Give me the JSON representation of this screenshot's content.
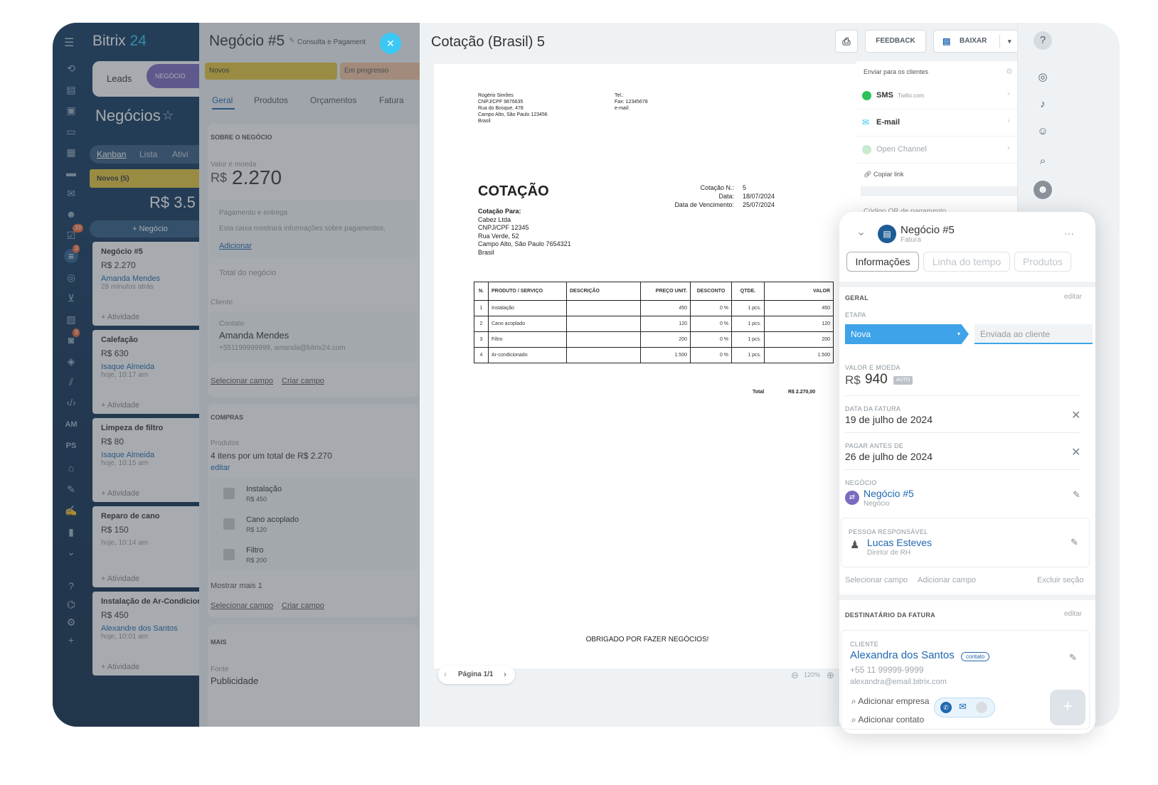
{
  "rail": {
    "brand_name": "Bitrix",
    "brand_num": "24",
    "badge_tasks": "33",
    "badge_crm": "3",
    "badge_mail": "3",
    "label_am": "AM",
    "label_ps": "PS"
  },
  "kanban": {
    "tab_leads": "Leads",
    "tab_deal": "NEGÓCIO",
    "title": "Negócios",
    "views": [
      "Kanban",
      "Lista",
      "Ativi"
    ],
    "column_name": "Novos (5)",
    "column_total": "R$ 3.5",
    "add_deal": "+ Negócio",
    "cards": [
      {
        "title": "Negócio #5",
        "price": "R$ 2.270",
        "person": "Amanda Mendes",
        "date": "28 minutos atrás",
        "activity": "+ Atividade"
      },
      {
        "title": "Calefação",
        "price": "R$ 630",
        "person": "Isaque Almeida",
        "date": "hoje, 10:17 am",
        "activity": "+ Atividade"
      },
      {
        "title": "Limpeza de filtro",
        "price": "R$ 80",
        "person": "Isaque Almeida",
        "date": "hoje, 10:15 am",
        "activity": "+ Atividade"
      },
      {
        "title": "Reparo de cano",
        "price": "R$ 150",
        "person": "",
        "date": "hoje, 10:14 am",
        "activity": "+ Atividade"
      },
      {
        "title": "Instalação de Ar-Condicion",
        "price": "R$ 450",
        "person": "Alexandre dos Santos",
        "date": "hoje, 10:01 am",
        "activity": "+ Atividade"
      }
    ]
  },
  "deal": {
    "title": "Negócio #5",
    "subtitle": "Consulta e Pagament",
    "stage_current": "Novos",
    "stage_next": "Em progresso",
    "tabs": [
      "Geral",
      "Produtos",
      "Orçamentos",
      "Fatura"
    ],
    "about_header": "SOBRE O NEGÓCIO",
    "value_label": "Valor e moeda",
    "currency": "R$",
    "amount": "2.270",
    "payment_label": "Pagamento e entrega",
    "payment_text": "Esta caixa mostrará informações sobre pagamentos,",
    "payment_add": "Adicionar",
    "total_label": "Total do negócio",
    "client_label": "Cliente",
    "contact_label": "Contato",
    "contact_name": "Amanda Mendes",
    "contact_info": "+551199999999, amanda@bitrix24.com",
    "select_field": "Selecionar campo",
    "create_field": "Criar campo",
    "purchases_header": "COMPRAS",
    "products_label": "Produtos",
    "products_summary": "4 itens por um total de R$ 2.270",
    "products_edit": "editar",
    "products": [
      {
        "name": "Instalação",
        "price": "R$ 450"
      },
      {
        "name": "Cano acoplado",
        "price": "R$ 120"
      },
      {
        "name": "Filtro",
        "price": "R$ 200"
      }
    ],
    "show_more": "Mostrar mais 1",
    "more_header": "MAIS",
    "source_label": "Fonte",
    "source_value": "Publicidade"
  },
  "viewer": {
    "title": "Cotação (Brasil) 5",
    "feedback": "FEEDBACK",
    "download": "BAIXAR",
    "page_label": "Página 1/1",
    "zoom": "120%"
  },
  "document": {
    "seller_lines": [
      "Rogério Simões",
      "CNPJ/CPF 9876635",
      "Rua do Bosque, 478",
      "Campo Alto, São Paulo 123456",
      "Brasil"
    ],
    "seller_contact": [
      "Tel.:",
      "Fax: 12345678",
      "e-mail:"
    ],
    "heading": "COTAÇÃO",
    "meta_labels": [
      "Cotação N.:",
      "Data:",
      "Data de Vencimento:"
    ],
    "meta_values": [
      "5",
      "18/07/2024",
      "25/07/2024"
    ],
    "to_label": "Cotação Para:",
    "to_lines": [
      "Cabez Ltda",
      "CNPJ/CPF 12345",
      "Rua Verde, 52",
      "Campo Alto, São Paulo 7654321",
      "Brasil"
    ],
    "columns": [
      "N.",
      "PRODUTO / SERVIÇO",
      "DESCRIÇÃO",
      "PREÇO UNIT.",
      "DESCONTO",
      "QTDE.",
      "VALOR"
    ],
    "rows": [
      [
        "1",
        "Instalação",
        "",
        "450",
        "0 %",
        "1 pcs.",
        "450"
      ],
      [
        "2",
        "Cano acoplado",
        "",
        "120",
        "0 %",
        "1 pcs.",
        "120"
      ],
      [
        "3",
        "Filtro",
        "",
        "200",
        "0 %",
        "1 pcs.",
        "200"
      ],
      [
        "4",
        "Ar-condicionado",
        "",
        "1.500",
        "0 %",
        "1 pcs.",
        "1.500"
      ]
    ],
    "total_label": "Total",
    "total_value": "R$ 2.270,00",
    "thanks": "OBRIGADO POR FAZER NEGÓCIOS!"
  },
  "send": {
    "header": "Enviar para os clientes",
    "sms": "SMS",
    "sms_provider": "Twilio.com",
    "email": "E-mail",
    "open_channel": "Open Channel",
    "copy_link": "Copiar link",
    "qr_label": "Código QR de pagamento"
  },
  "invoice": {
    "title": "Negócio #5",
    "subtitle": "Fatura",
    "tabs": [
      "Informações",
      "Linha do tempo",
      "Produtos"
    ],
    "general_header": "GERAL",
    "edit": "editar",
    "stage_label": "ETAPA",
    "stage_current": "Nova",
    "stage_next": "Enviada ao cliente",
    "value_label": "VALOR E MOEDA",
    "currency": "R$",
    "amount": "940",
    "auto_badge": "AUTO",
    "invoice_date_label": "DATA DA FATURA",
    "invoice_date": "19 de julho de 2024",
    "pay_before_label": "PAGAR ANTES DE",
    "pay_before": "26 de julho de 2024",
    "deal_label": "NEGÓCIO",
    "deal_name": "Negócio #5",
    "deal_type": "Negócio",
    "responsible_label": "PESSOA RESPONSÁVEL",
    "responsible_name": "Lucas Esteves",
    "responsible_role": "Diretor de RH",
    "select_field": "Selecionar campo",
    "add_field": "Adicionar campo",
    "delete_section": "Excluir seção",
    "recipient_header": "DESTINATÁRIO DA FATURA",
    "client_label": "CLIENTE",
    "client_name": "Alexandra dos Santos",
    "client_badge": "contato",
    "client_phone": "+55 11 99999-9999",
    "client_email": "alexandra@email.bitrix.com",
    "add_company": "Adicionar empresa",
    "add_contact": "Adicionar contato"
  },
  "colors": {
    "rail_bg": "#123a62",
    "accent_blue": "#2fc6f6",
    "stage_blue": "#3ea3e8",
    "stage_yellow": "#e5c73a",
    "deal_purple": "#7b6ac0",
    "link_blue": "#2067b0"
  }
}
